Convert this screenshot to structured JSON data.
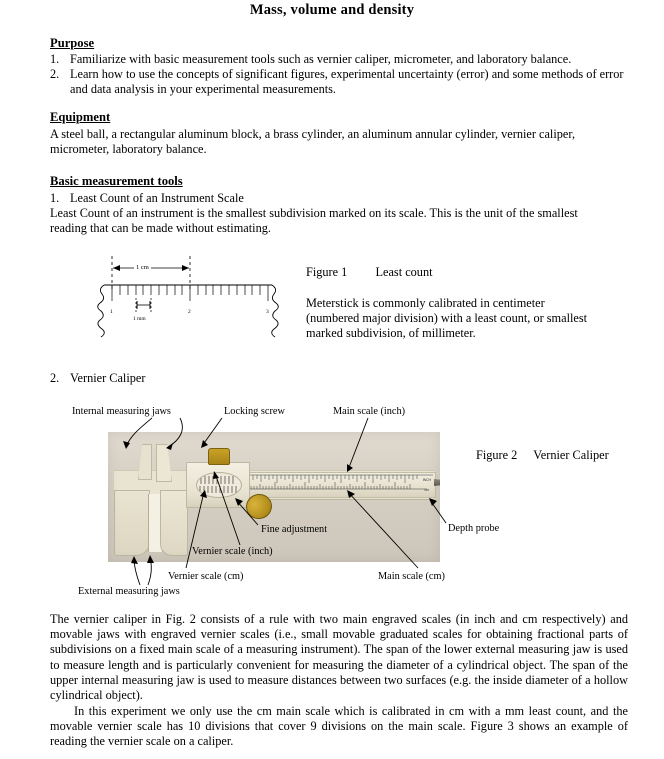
{
  "document": {
    "title": "Mass, volume and density"
  },
  "sections": {
    "purpose": {
      "heading": "Purpose",
      "items": [
        {
          "num": "1.",
          "text": "Familiarize with basic measurement tools such as vernier caliper, micrometer, and laboratory balance."
        },
        {
          "num": "2.",
          "text": "Learn how to use the concepts of significant figures, experimental uncertainty (error) and some methods of error and data analysis in your experimental measurements."
        }
      ]
    },
    "equipment": {
      "heading": "Equipment",
      "text": "A steel ball, a rectangular aluminum block, a brass cylinder, an aluminum annular cylinder, vernier caliper, micrometer, laboratory balance."
    },
    "basic_tools": {
      "heading": "Basic measurement tools",
      "item1_num": "1.",
      "item1_label": "Least Count of an Instrument Scale",
      "item1_text": "Least Count of an instrument is the smallest subdivision marked on its scale. This is the unit of the smallest reading that can be made without estimating.",
      "item2_num": "2.",
      "item2_label": "Vernier Caliper"
    }
  },
  "figure1": {
    "caption_label": "Figure 1",
    "caption_title": "Least count",
    "note": "Meterstick is commonly calibrated in centimeter (numbered major division) with a least count, or smallest marked subdivision, of millimeter.",
    "ruler": {
      "span_label": "1 cm",
      "small_label": "1 mm",
      "tick_numbers": [
        "1",
        "2",
        "3"
      ]
    }
  },
  "figure2": {
    "caption_label": "Figure 2",
    "caption_title": "Vernier Caliper",
    "annotations": {
      "internal_jaws": "Internal measuring jaws",
      "locking_screw": "Locking screw",
      "main_scale_inch": "Main scale (inch)",
      "fine_adjustment": "Fine adjustment",
      "depth_probe": "Depth probe",
      "vernier_scale_inch": "Vernier scale (inch)",
      "vernier_scale_cm": "Vernier scale (cm)",
      "main_scale_cm": "Main scale (cm)",
      "external_jaws": "External measuring jaws"
    },
    "photo_scale_marks": {
      "inch": "INCH",
      "cm": "cm"
    }
  },
  "body": {
    "para1": "The vernier caliper in Fig. 2 consists of a rule with two main engraved scales (in inch and cm respectively) and movable jaws with engraved vernier scales (i.e., small movable graduated scales for obtaining fractional parts of subdivisions on a fixed main scale of a measuring instrument). The span of the lower external measuring jaw is used to measure length and is particularly convenient for measuring the diameter of a cylindrical object. The span of the upper internal measuring jaw is used to measure distances between two surfaces (e.g. the inside diameter of a hollow cylindrical object).",
    "para2": "In this experiment we only use the cm main scale which is calibrated in cm with a mm least count, and the movable vernier scale has 10 divisions that cover 9 divisions on the main scale. Figure 3 shows an example of reading the vernier scale on a caliper."
  },
  "colors": {
    "text": "#000000",
    "photo_background": "#d9d3c7",
    "caliper_body": "#e9e4d2",
    "brass": "#b08b19"
  }
}
